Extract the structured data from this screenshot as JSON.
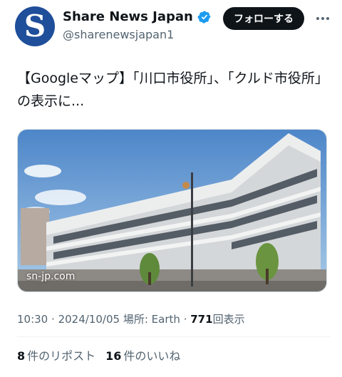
{
  "account": {
    "display_name": "Share News Japan",
    "handle": "@sharenewsjapan1",
    "avatar_letter": "S",
    "brand_color": "#1f4e9a",
    "verified": true
  },
  "follow_label": "フォローする",
  "tweet": {
    "text": "【Googleマップ】「川口市役所」、「クルド市役所」の表示に..."
  },
  "media": {
    "watermark": "sn-jp.com"
  },
  "meta": {
    "time": "10:30",
    "date": "2024/10/05",
    "location_prefix": "場所:",
    "location": "Earth",
    "views": "771",
    "views_label": "回表示"
  },
  "stats": {
    "reposts_count": "8",
    "reposts_label": "件のリポスト",
    "likes_count": "16",
    "likes_label": "件のいいね"
  },
  "colors": {
    "text": "#0f1419",
    "secondary": "#536471",
    "verified": "#1d9bf0"
  }
}
